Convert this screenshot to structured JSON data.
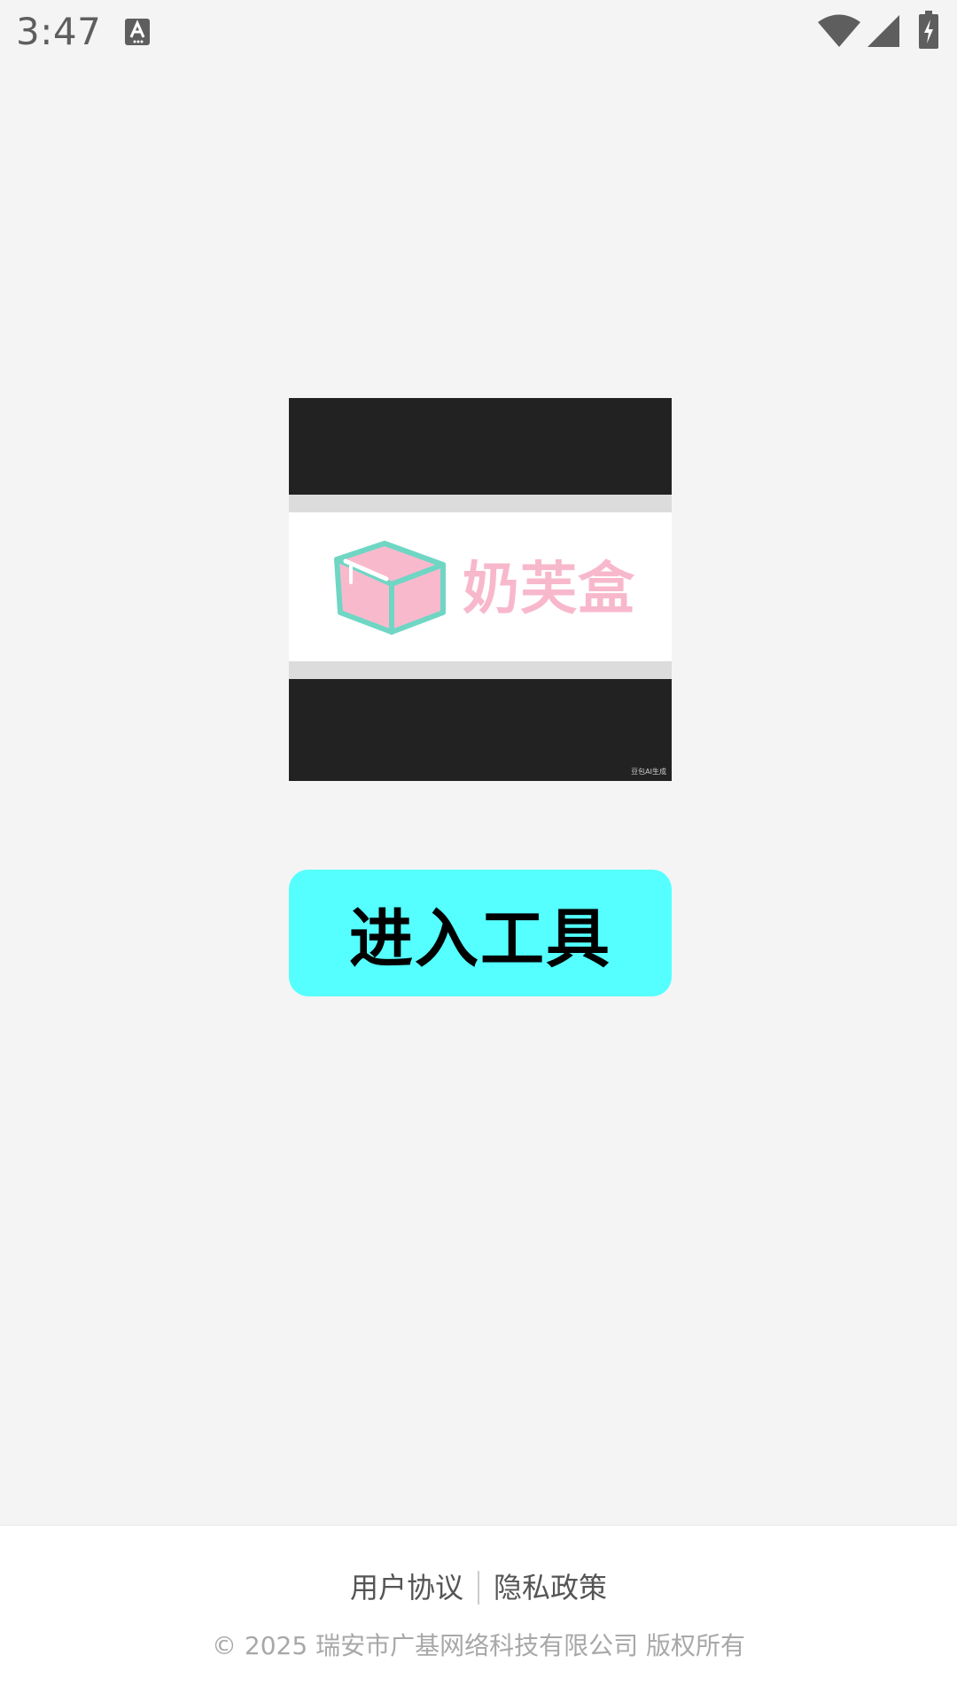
{
  "status_bar": {
    "time": "3:47",
    "icons": [
      "a-notification-icon",
      "wifi-icon",
      "signal-icon",
      "battery-charging-icon"
    ]
  },
  "logo": {
    "brand_text": "奶芙盒",
    "watermark": "豆包AI生成",
    "colors": {
      "text": "#f8b8cc",
      "box_outline": "#6fd6c4",
      "box_fill": "#f9b9cd"
    }
  },
  "main": {
    "enter_button_label": "进入工具",
    "enter_button_color": "#55ffff"
  },
  "footer": {
    "user_agreement": "用户协议",
    "privacy_policy": "隐私政策",
    "copyright": "© 2025 瑞安市广基网络科技有限公司 版权所有"
  }
}
